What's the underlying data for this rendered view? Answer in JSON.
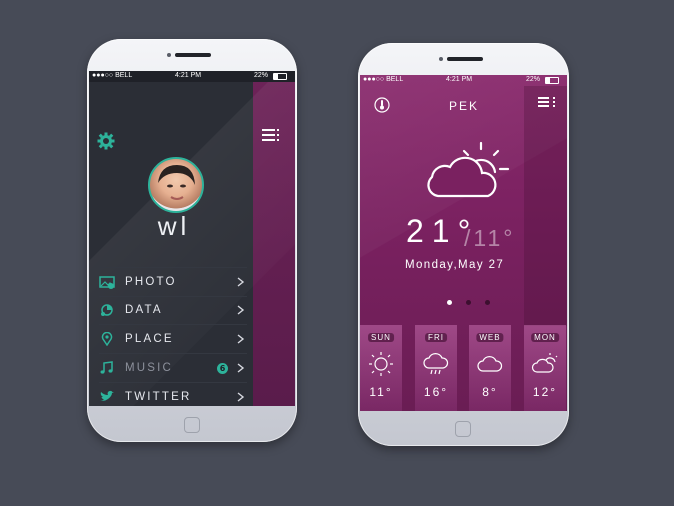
{
  "status_bar": {
    "carrier": "●●●○○ BELL",
    "time": "4:21 PM",
    "battery": "22%"
  },
  "left_phone": {
    "username": "wl",
    "menu": [
      {
        "label": "PHOTO",
        "icon": "photo-icon"
      },
      {
        "label": "DATA",
        "icon": "data-icon"
      },
      {
        "label": "PLACE",
        "icon": "location-pin-icon"
      },
      {
        "label": "MUSIC",
        "icon": "music-note-icon",
        "badge": "6"
      },
      {
        "label": "TWITTER",
        "icon": "twitter-bird-icon"
      }
    ]
  },
  "right_phone": {
    "city": "PEK",
    "temperature": "21°",
    "temperature_low": "/11°",
    "date": "Monday,May 27",
    "page_count": 3,
    "active_page": 0,
    "forecast": [
      {
        "day": "SUN",
        "temp": "11°",
        "icon": "sun-icon"
      },
      {
        "day": "FRI",
        "temp": "16°",
        "icon": "rain-cloud-icon"
      },
      {
        "day": "WEB",
        "temp": "8°",
        "icon": "cloud-icon"
      },
      {
        "day": "MON",
        "temp": "12°",
        "icon": "partly-cloudy-icon"
      }
    ]
  },
  "colors": {
    "background": "#474b57",
    "panel_dark": "#2b2e36",
    "purple": "#78225f",
    "accent_teal": "#2db39b"
  }
}
